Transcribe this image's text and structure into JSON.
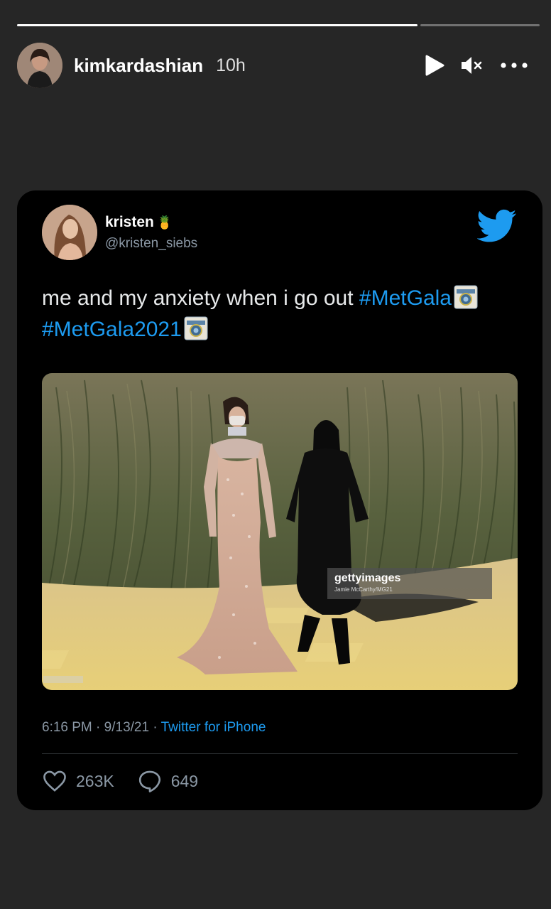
{
  "story": {
    "username": "kimkardashian",
    "time": "10h",
    "progress_done": 0.77
  },
  "icons": {
    "play": "play-icon",
    "mute": "mute-icon",
    "more": "more-icon"
  },
  "tweet": {
    "name": "kristen",
    "name_emoji": "🍍",
    "handle": "@kristen_siebs",
    "text": "me and my anxiety when i go out ",
    "hashtag1": "#MetGala",
    "hashtag2": "#MetGala2021",
    "media": {
      "watermark": "gettyimages",
      "credit": "Jamie McCarthy/MG21"
    },
    "time": "6:16 PM",
    "date": "9/13/21",
    "source": "Twitter for iPhone",
    "likes": "263K",
    "replies": "649"
  },
  "colors": {
    "background": "#262626",
    "card": "#000000",
    "link": "#1d9bf0",
    "muted": "#8b98a5"
  }
}
